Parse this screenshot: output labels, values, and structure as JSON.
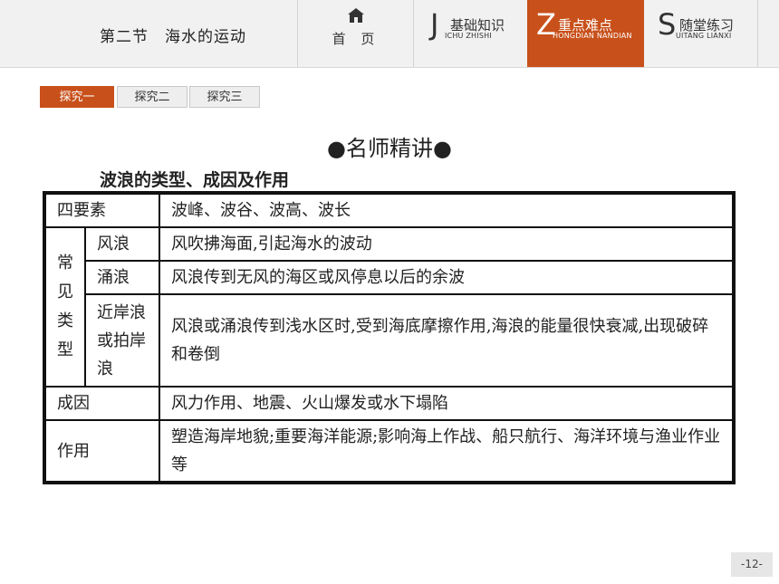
{
  "header": {
    "lesson_title": "第二节　海水的运动",
    "home_label": "首 页",
    "nav": [
      {
        "letter": "J",
        "label": "基础知识",
        "pinyin": "ICHU ZHISHI",
        "active": false
      },
      {
        "letter": "Z",
        "label": "重点难点",
        "pinyin": "HONGDIAN NANDIAN",
        "active": true
      },
      {
        "letter": "S",
        "label": "随堂练习",
        "pinyin": "UITANG LIANXI",
        "active": false
      }
    ]
  },
  "tabs": [
    "探究一",
    "探究二",
    "探究三"
  ],
  "section_heading": "●名师精讲●",
  "subheading": "波浪的类型、成因及作用",
  "table": {
    "elements_label": "四要素",
    "elements_value": "波峰、波谷、波高、波长",
    "types_label": "常见类型",
    "types_label_chars": [
      "常",
      "见",
      "类",
      "型"
    ],
    "types": [
      {
        "name": "风浪",
        "desc": "风吹拂海面,引起海水的波动"
      },
      {
        "name": "涌浪",
        "desc": "风浪传到无风的海区或风停息以后的余波"
      },
      {
        "name": "近岸浪或拍岸浪",
        "desc": "风浪或涌浪传到浅水区时,受到海底摩擦作用,海浪的能量很快衰减,出现破碎和卷倒"
      }
    ],
    "cause_label": "成因",
    "cause_value": "风力作用、地震、火山爆发或水下塌陷",
    "effect_label": "作用",
    "effect_value": "塑造海岸地貌;重要海洋能源;影响海上作战、船只航行、海洋环境与渔业作业等"
  },
  "page_number": "-12-",
  "colors": {
    "accent": "#c8501a",
    "header_bg": "#f1f1f1"
  },
  "icons": {
    "home": "home-icon"
  }
}
